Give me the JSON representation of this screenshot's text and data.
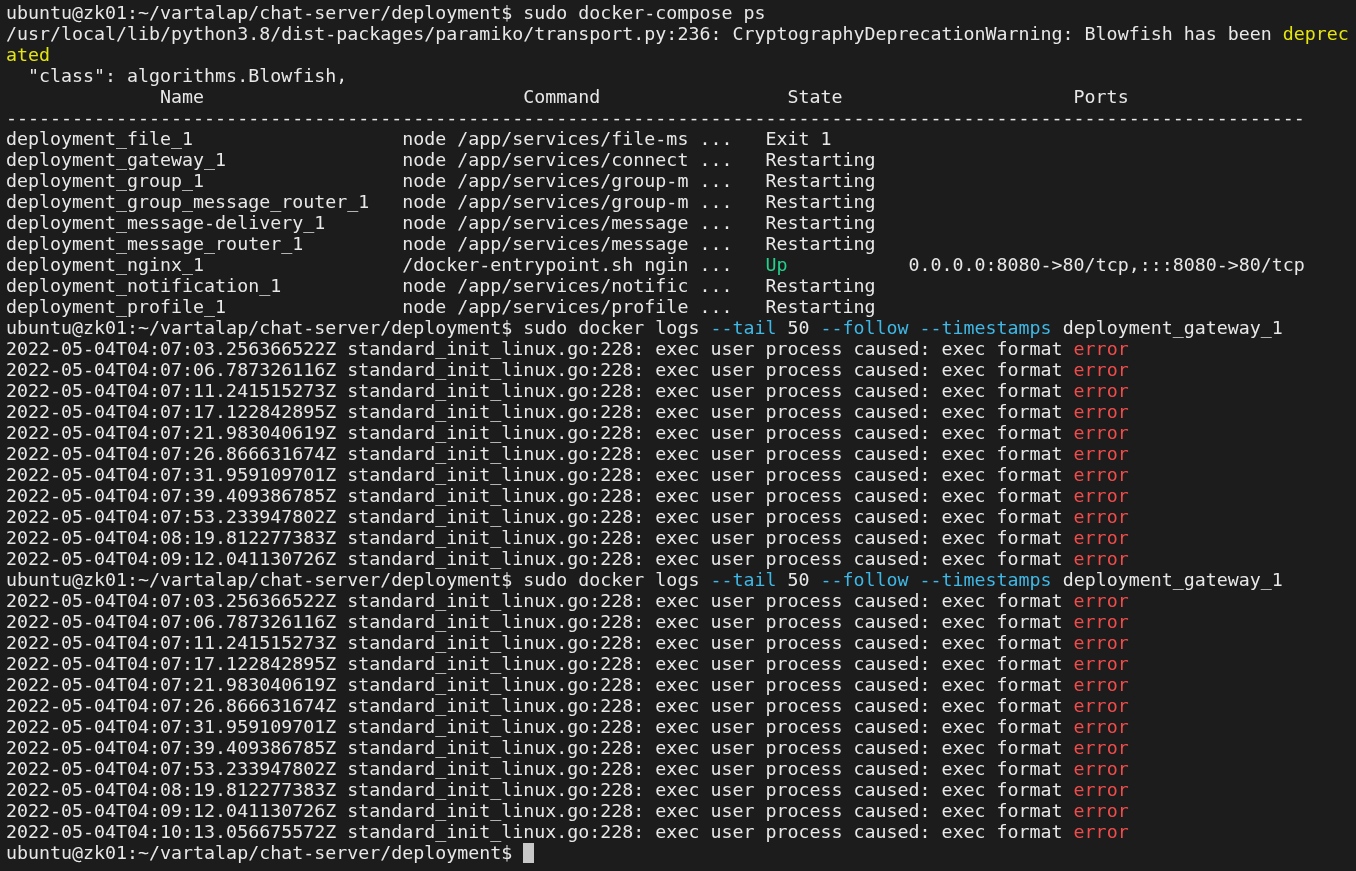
{
  "terminal": {
    "cursor": true,
    "lines": [
      {
        "segments": [
          {
            "text": "ubuntu@zk01:~/vartalap/chat-server/deployment$ sudo docker-compose ps",
            "kind": "plain"
          }
        ]
      },
      {
        "segments": [
          {
            "text": "/usr/local/lib/python3.8/dist-packages/paramiko/transport.py:236: CryptographyDeprecationWarning: Blowfish has been ",
            "kind": "plain"
          },
          {
            "text": "deprec",
            "kind": "warning"
          }
        ]
      },
      {
        "segments": [
          {
            "text": "ated",
            "kind": "warning"
          }
        ]
      },
      {
        "segments": [
          {
            "text": "  \"class\": algorithms.Blowfish,",
            "kind": "plain"
          }
        ]
      },
      {
        "segments": [
          {
            "text": "              Name                             Command                 State                     Ports",
            "kind": "plain"
          }
        ]
      },
      {
        "segments": [
          {
            "text": "----------------------------------------------------------------------------------------------------------------------",
            "kind": "plain"
          }
        ]
      },
      {
        "segments": [
          {
            "text": "deployment_file_1                   node /app/services/file-ms ...   ",
            "kind": "plain"
          },
          {
            "text": "Exit 1",
            "kind": "plain"
          }
        ]
      },
      {
        "segments": [
          {
            "text": "deployment_gateway_1                node /app/services/connect ...   ",
            "kind": "plain"
          },
          {
            "text": "Restarting",
            "kind": "plain"
          }
        ]
      },
      {
        "segments": [
          {
            "text": "deployment_group_1                  node /app/services/group-m ...   ",
            "kind": "plain"
          },
          {
            "text": "Restarting",
            "kind": "plain"
          }
        ]
      },
      {
        "segments": [
          {
            "text": "deployment_group_message_router_1   node /app/services/group-m ...   ",
            "kind": "plain"
          },
          {
            "text": "Restarting",
            "kind": "plain"
          }
        ]
      },
      {
        "segments": [
          {
            "text": "deployment_message-delivery_1       node /app/services/message ...   ",
            "kind": "plain"
          },
          {
            "text": "Restarting",
            "kind": "plain"
          }
        ]
      },
      {
        "segments": [
          {
            "text": "deployment_message_router_1         node /app/services/message ...   ",
            "kind": "plain"
          },
          {
            "text": "Restarting",
            "kind": "plain"
          }
        ]
      },
      {
        "segments": [
          {
            "text": "deployment_nginx_1                  /docker-entrypoint.sh ngin ...   ",
            "kind": "plain"
          },
          {
            "text": "Up",
            "kind": "ok"
          },
          {
            "text": "           0.0.0.0:8080->80/tcp,:::8080->80/tcp",
            "kind": "plain"
          }
        ]
      },
      {
        "segments": [
          {
            "text": "deployment_notification_1           node /app/services/notific ...   ",
            "kind": "plain"
          },
          {
            "text": "Restarting",
            "kind": "plain"
          }
        ]
      },
      {
        "segments": [
          {
            "text": "deployment_profile_1                node /app/services/profile ...   ",
            "kind": "plain"
          },
          {
            "text": "Restarting",
            "kind": "plain"
          }
        ]
      },
      {
        "segments": [
          {
            "text": "ubuntu@zk01:~/vartalap/chat-server/deployment$ sudo docker logs ",
            "kind": "plain"
          },
          {
            "text": "--tail",
            "kind": "option"
          },
          {
            "text": " 50 ",
            "kind": "plain"
          },
          {
            "text": "--follow --timestamps",
            "kind": "option"
          },
          {
            "text": " deployment_gateway_1",
            "kind": "plain"
          }
        ]
      },
      {
        "segments": [
          {
            "text": "2022-05-04T04:07:03.256366522Z standard_init_linux.go:228: exec user process caused: exec format ",
            "kind": "plain"
          },
          {
            "text": "error",
            "kind": "error"
          }
        ]
      },
      {
        "segments": [
          {
            "text": "2022-05-04T04:07:06.787326116Z standard_init_linux.go:228: exec user process caused: exec format ",
            "kind": "plain"
          },
          {
            "text": "error",
            "kind": "error"
          }
        ]
      },
      {
        "segments": [
          {
            "text": "2022-05-04T04:07:11.241515273Z standard_init_linux.go:228: exec user process caused: exec format ",
            "kind": "plain"
          },
          {
            "text": "error",
            "kind": "error"
          }
        ]
      },
      {
        "segments": [
          {
            "text": "2022-05-04T04:07:17.122842895Z standard_init_linux.go:228: exec user process caused: exec format ",
            "kind": "plain"
          },
          {
            "text": "error",
            "kind": "error"
          }
        ]
      },
      {
        "segments": [
          {
            "text": "2022-05-04T04:07:21.983040619Z standard_init_linux.go:228: exec user process caused: exec format ",
            "kind": "plain"
          },
          {
            "text": "error",
            "kind": "error"
          }
        ]
      },
      {
        "segments": [
          {
            "text": "2022-05-04T04:07:26.866631674Z standard_init_linux.go:228: exec user process caused: exec format ",
            "kind": "plain"
          },
          {
            "text": "error",
            "kind": "error"
          }
        ]
      },
      {
        "segments": [
          {
            "text": "2022-05-04T04:07:31.959109701Z standard_init_linux.go:228: exec user process caused: exec format ",
            "kind": "plain"
          },
          {
            "text": "error",
            "kind": "error"
          }
        ]
      },
      {
        "segments": [
          {
            "text": "2022-05-04T04:07:39.409386785Z standard_init_linux.go:228: exec user process caused: exec format ",
            "kind": "plain"
          },
          {
            "text": "error",
            "kind": "error"
          }
        ]
      },
      {
        "segments": [
          {
            "text": "2022-05-04T04:07:53.233947802Z standard_init_linux.go:228: exec user process caused: exec format ",
            "kind": "plain"
          },
          {
            "text": "error",
            "kind": "error"
          }
        ]
      },
      {
        "segments": [
          {
            "text": "2022-05-04T04:08:19.812277383Z standard_init_linux.go:228: exec user process caused: exec format ",
            "kind": "plain"
          },
          {
            "text": "error",
            "kind": "error"
          }
        ]
      },
      {
        "segments": [
          {
            "text": "2022-05-04T04:09:12.041130726Z standard_init_linux.go:228: exec user process caused: exec format ",
            "kind": "plain"
          },
          {
            "text": "error",
            "kind": "error"
          }
        ]
      },
      {
        "segments": [
          {
            "text": "ubuntu@zk01:~/vartalap/chat-server/deployment$ sudo docker logs ",
            "kind": "plain"
          },
          {
            "text": "--tail",
            "kind": "option"
          },
          {
            "text": " 50 ",
            "kind": "plain"
          },
          {
            "text": "--follow --timestamps",
            "kind": "option"
          },
          {
            "text": " deployment_gateway_1",
            "kind": "plain"
          }
        ]
      },
      {
        "segments": [
          {
            "text": "2022-05-04T04:07:03.256366522Z standard_init_linux.go:228: exec user process caused: exec format ",
            "kind": "plain"
          },
          {
            "text": "error",
            "kind": "error"
          }
        ]
      },
      {
        "segments": [
          {
            "text": "2022-05-04T04:07:06.787326116Z standard_init_linux.go:228: exec user process caused: exec format ",
            "kind": "plain"
          },
          {
            "text": "error",
            "kind": "error"
          }
        ]
      },
      {
        "segments": [
          {
            "text": "2022-05-04T04:07:11.241515273Z standard_init_linux.go:228: exec user process caused: exec format ",
            "kind": "plain"
          },
          {
            "text": "error",
            "kind": "error"
          }
        ]
      },
      {
        "segments": [
          {
            "text": "2022-05-04T04:07:17.122842895Z standard_init_linux.go:228: exec user process caused: exec format ",
            "kind": "plain"
          },
          {
            "text": "error",
            "kind": "error"
          }
        ]
      },
      {
        "segments": [
          {
            "text": "2022-05-04T04:07:21.983040619Z standard_init_linux.go:228: exec user process caused: exec format ",
            "kind": "plain"
          },
          {
            "text": "error",
            "kind": "error"
          }
        ]
      },
      {
        "segments": [
          {
            "text": "2022-05-04T04:07:26.866631674Z standard_init_linux.go:228: exec user process caused: exec format ",
            "kind": "plain"
          },
          {
            "text": "error",
            "kind": "error"
          }
        ]
      },
      {
        "segments": [
          {
            "text": "2022-05-04T04:07:31.959109701Z standard_init_linux.go:228: exec user process caused: exec format ",
            "kind": "plain"
          },
          {
            "text": "error",
            "kind": "error"
          }
        ]
      },
      {
        "segments": [
          {
            "text": "2022-05-04T04:07:39.409386785Z standard_init_linux.go:228: exec user process caused: exec format ",
            "kind": "plain"
          },
          {
            "text": "error",
            "kind": "error"
          }
        ]
      },
      {
        "segments": [
          {
            "text": "2022-05-04T04:07:53.233947802Z standard_init_linux.go:228: exec user process caused: exec format ",
            "kind": "plain"
          },
          {
            "text": "error",
            "kind": "error"
          }
        ]
      },
      {
        "segments": [
          {
            "text": "2022-05-04T04:08:19.812277383Z standard_init_linux.go:228: exec user process caused: exec format ",
            "kind": "plain"
          },
          {
            "text": "error",
            "kind": "error"
          }
        ]
      },
      {
        "segments": [
          {
            "text": "2022-05-04T04:09:12.041130726Z standard_init_linux.go:228: exec user process caused: exec format ",
            "kind": "plain"
          },
          {
            "text": "error",
            "kind": "error"
          }
        ]
      },
      {
        "segments": [
          {
            "text": "2022-05-04T04:10:13.056675572Z standard_init_linux.go:228: exec user process caused: exec format ",
            "kind": "plain"
          },
          {
            "text": "error",
            "kind": "error"
          }
        ]
      },
      {
        "segments": [
          {
            "text": "ubuntu@zk01:~/vartalap/chat-server/deployment$ ",
            "kind": "plain"
          }
        ]
      }
    ]
  }
}
